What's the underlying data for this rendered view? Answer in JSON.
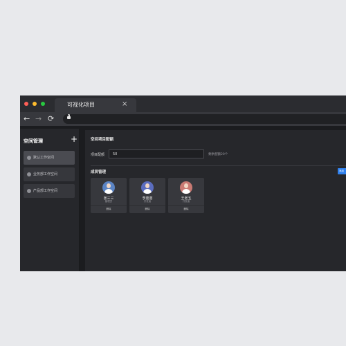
{
  "browser": {
    "tab_title": "可视化项目",
    "tab_close": "×",
    "nav": {
      "back": "←",
      "forward": "→",
      "reload": "⟳"
    }
  },
  "sidebar": {
    "title": "空间管理",
    "add_icon": "+",
    "items": [
      {
        "label": "默认工作空间",
        "active": true
      },
      {
        "label": "业务部工作空间",
        "active": false
      },
      {
        "label": "产品部工作空间",
        "active": false
      }
    ]
  },
  "main": {
    "quota_section_title": "空间项目配额",
    "quota_label": "项目配额",
    "quota_value": "50",
    "quota_hint": "剩余配额20个",
    "members_title": "成员管理",
    "action_button": "添加",
    "members": [
      {
        "name": "张三三",
        "role": "管理员",
        "delete": "删除",
        "avatar_color": "#5b84c4"
      },
      {
        "name": "李嘉嘉",
        "role": "开发者",
        "delete": "删除",
        "avatar_color": "#5b6dbf"
      },
      {
        "name": "王老五",
        "role": "开发者",
        "delete": "删除",
        "avatar_color": "#c97a73"
      }
    ]
  },
  "colors": {
    "accent": "#2f80ed",
    "background": "#26272b",
    "card": "#37383d"
  }
}
